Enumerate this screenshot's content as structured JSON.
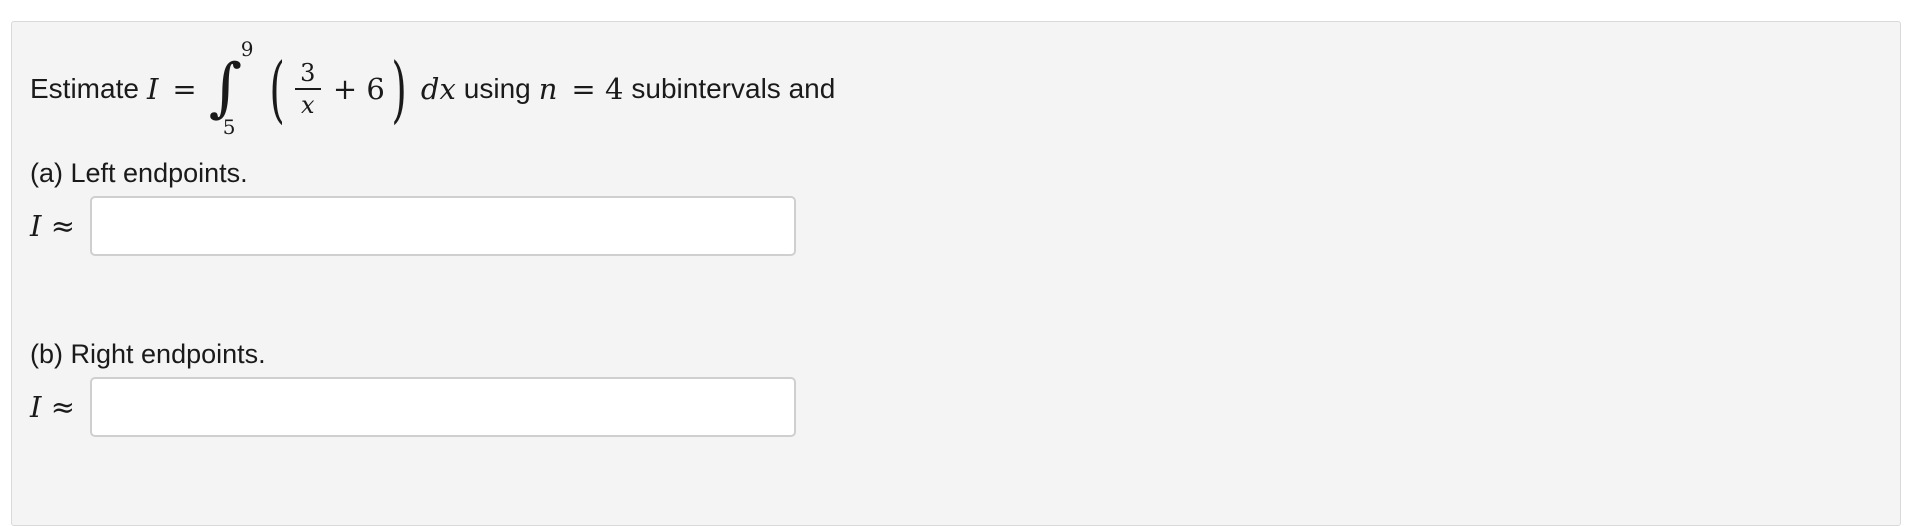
{
  "problem": {
    "prefix": "Estimate",
    "integral_var": "I",
    "equals": "=",
    "upper_limit": "9",
    "lower_limit": "5",
    "numerator": "3",
    "denominator": "x",
    "plus_const": "+ 6",
    "differential": "dx",
    "using_text": "using",
    "n_var": "n",
    "n_equals": "= 4",
    "suffix": "subintervals and"
  },
  "part_a": {
    "label": "(a) Left endpoints.",
    "approx_var": "I",
    "approx_sign": "≈",
    "value": ""
  },
  "part_b": {
    "label": "(b) Right endpoints.",
    "approx_var": "I",
    "approx_sign": "≈",
    "value": ""
  }
}
